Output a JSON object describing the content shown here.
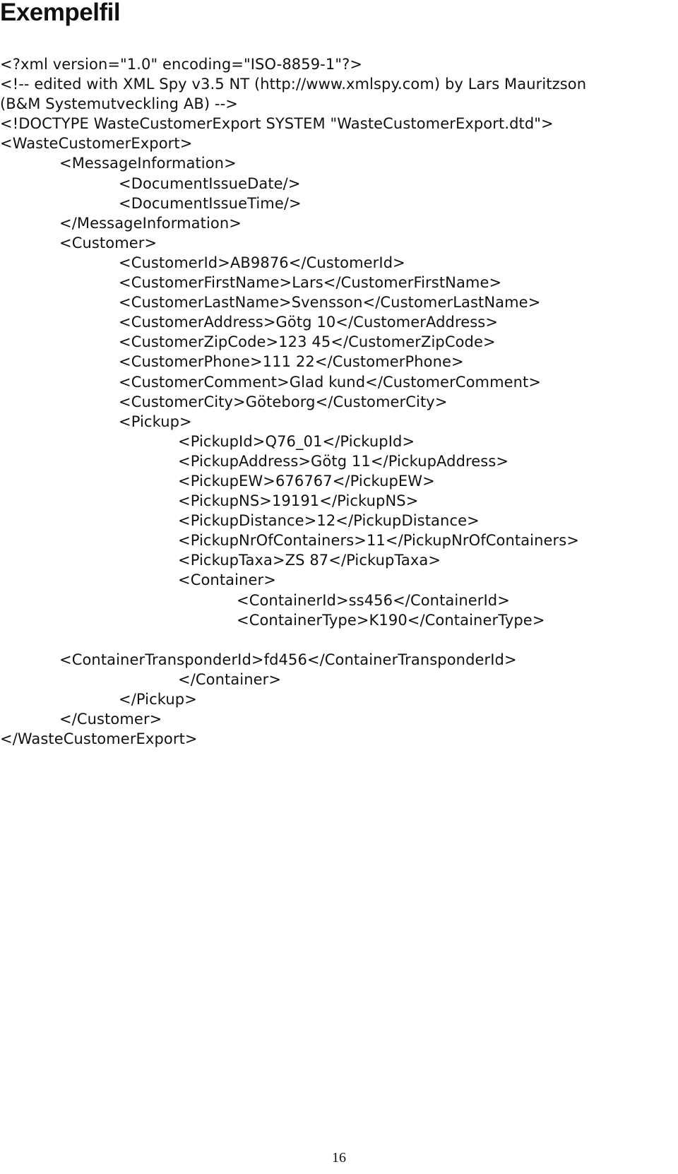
{
  "title": "Exempelfil",
  "xml_lines": [
    {
      "indent": 0,
      "text": "<?xml version=\"1.0\" encoding=\"ISO-8859-1\"?>"
    },
    {
      "indent": 0,
      "text": "<!-- edited with XML Spy v3.5 NT (http://www.xmlspy.com) by Lars Mauritzson"
    },
    {
      "indent": 0,
      "text": "(B&M Systemutveckling AB) -->"
    },
    {
      "indent": 0,
      "text": "<!DOCTYPE WasteCustomerExport SYSTEM \"WasteCustomerExport.dtd\">"
    },
    {
      "indent": 0,
      "text": "<WasteCustomerExport>"
    },
    {
      "indent": 1,
      "text": "<MessageInformation>"
    },
    {
      "indent": 2,
      "text": "<DocumentIssueDate/>"
    },
    {
      "indent": 2,
      "text": "<DocumentIssueTime/>"
    },
    {
      "indent": 1,
      "text": "</MessageInformation>"
    },
    {
      "indent": 1,
      "text": "<Customer>"
    },
    {
      "indent": 2,
      "text": "<CustomerId>AB9876</CustomerId>"
    },
    {
      "indent": 2,
      "text": "<CustomerFirstName>Lars</CustomerFirstName>"
    },
    {
      "indent": 2,
      "text": "<CustomerLastName>Svensson</CustomerLastName>"
    },
    {
      "indent": 2,
      "text": "<CustomerAddress>Götg 10</CustomerAddress>"
    },
    {
      "indent": 2,
      "text": "<CustomerZipCode>123 45</CustomerZipCode>"
    },
    {
      "indent": 2,
      "text": "<CustomerPhone>111 22</CustomerPhone>"
    },
    {
      "indent": 2,
      "text": "<CustomerComment>Glad kund</CustomerComment>"
    },
    {
      "indent": 2,
      "text": "<CustomerCity>Göteborg</CustomerCity>"
    },
    {
      "indent": 2,
      "text": "<Pickup>"
    },
    {
      "indent": 3,
      "text": "<PickupId>Q76_01</PickupId>"
    },
    {
      "indent": 3,
      "text": "<PickupAddress>Götg 11</PickupAddress>"
    },
    {
      "indent": 3,
      "text": "<PickupEW>676767</PickupEW>"
    },
    {
      "indent": 3,
      "text": "<PickupNS>19191</PickupNS>"
    },
    {
      "indent": 3,
      "text": "<PickupDistance>12</PickupDistance>"
    },
    {
      "indent": 3,
      "text": "<PickupNrOfContainers>11</PickupNrOfContainers>"
    },
    {
      "indent": 3,
      "text": "<PickupTaxa>ZS 87</PickupTaxa>"
    },
    {
      "indent": 3,
      "text": "<Container>"
    },
    {
      "indent": 4,
      "text": "<ContainerId>ss456</ContainerId>"
    },
    {
      "indent": 4,
      "text": "<ContainerType>K190</ContainerType>"
    },
    {
      "indent": 0,
      "text": ""
    },
    {
      "indent": 1,
      "text": "<ContainerTransponderId>fd456</ContainerTransponderId>"
    },
    {
      "indent": 3,
      "text": "</Container>"
    },
    {
      "indent": 2,
      "text": "</Pickup>"
    },
    {
      "indent": 1,
      "text": "</Customer>"
    },
    {
      "indent": 0,
      "text": "</WasteCustomerExport>"
    }
  ],
  "page_number": "16"
}
